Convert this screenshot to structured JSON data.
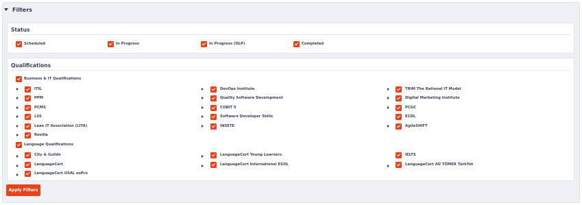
{
  "filters": {
    "title": "Filters"
  },
  "status": {
    "title": "Status",
    "items": [
      {
        "label": "Scheduled"
      },
      {
        "label": "In Progress"
      },
      {
        "label": "In Progress (OLP)"
      },
      {
        "label": "Completed"
      }
    ]
  },
  "qualifications": {
    "title": "Qualifications",
    "business": {
      "label": "Business & IT Qualifications",
      "items": [
        {
          "label": "ITIL"
        },
        {
          "label": "DevOps Institute"
        },
        {
          "label": "TRIM The Rational IT Model"
        },
        {
          "label": "PPM"
        },
        {
          "label": "Quality Software Development"
        },
        {
          "label": "Digital Marketing Institute"
        },
        {
          "label": "PCMS"
        },
        {
          "label": "COBIT 5"
        },
        {
          "label": "PCGC"
        },
        {
          "label": "LSS"
        },
        {
          "label": "Software Developer Skills"
        },
        {
          "label": "ECDL"
        },
        {
          "label": "Lean IT Association (LITA)"
        },
        {
          "label": "INSETE"
        },
        {
          "label": "AgileSHIFT"
        },
        {
          "label": "Resilia"
        }
      ]
    },
    "language": {
      "label": "Language Qualifications",
      "items": [
        {
          "label": "City & Guilds"
        },
        {
          "label": "LanguageCert Young Learners"
        },
        {
          "label": "IELTS"
        },
        {
          "label": "LanguageCert"
        },
        {
          "label": "LanguageCert International ESOL"
        },
        {
          "label": "LanguageCert AÜ TÖMER TürkYet"
        },
        {
          "label": "LanguageCert USAL esPro"
        }
      ]
    }
  },
  "apply_button": {
    "label": "Apply Filters"
  },
  "colors": {
    "accent": "#e8421a",
    "panel_bg": "#eef0f4",
    "text": "#3a4256"
  }
}
